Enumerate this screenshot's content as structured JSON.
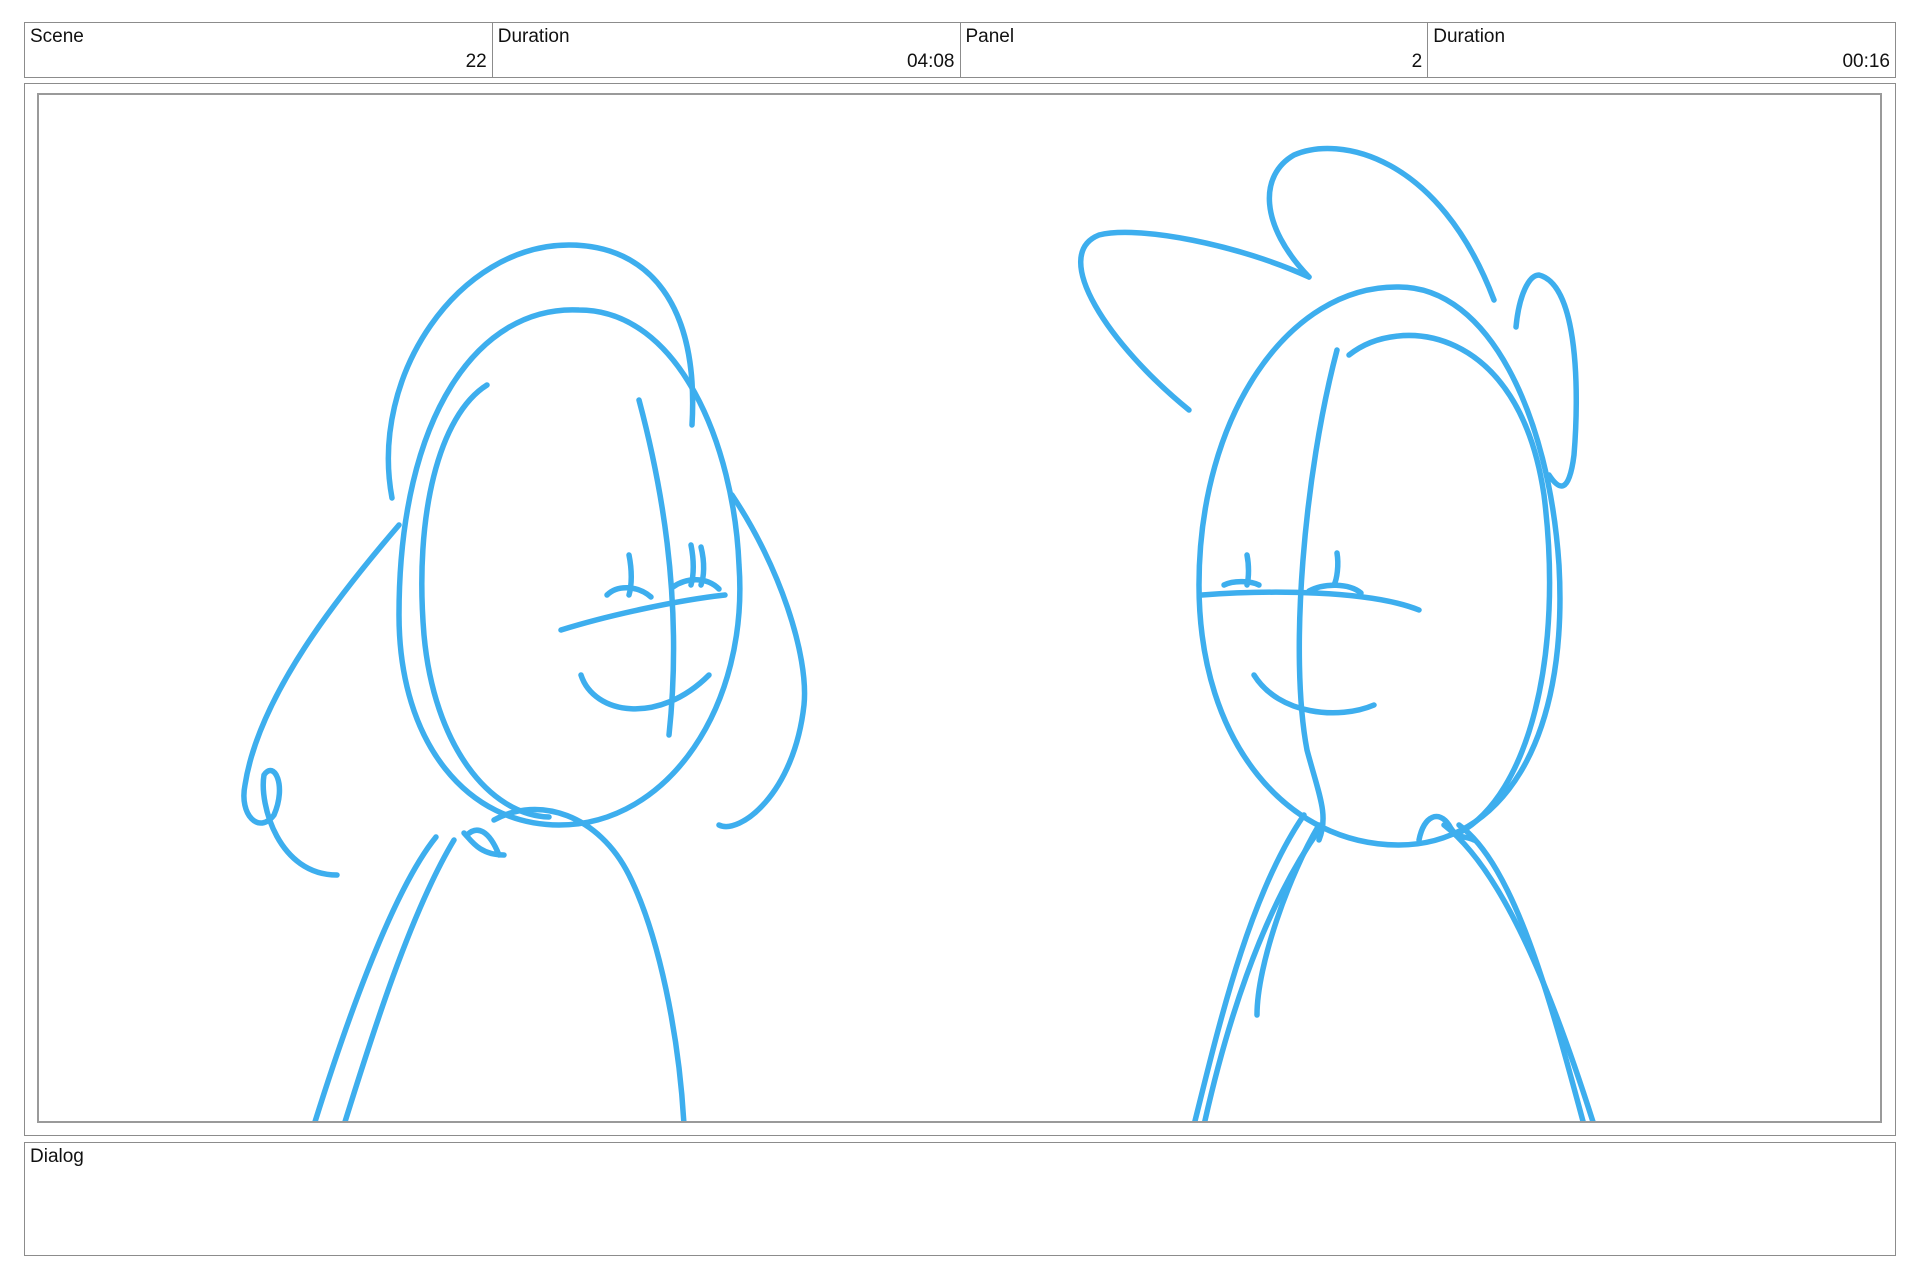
{
  "header": {
    "cells": [
      {
        "label": "Scene",
        "value": "22"
      },
      {
        "label": "Duration",
        "value": "04:08"
      },
      {
        "label": "Panel",
        "value": "2"
      },
      {
        "label": "Duration",
        "value": "00:16"
      }
    ]
  },
  "dialog": {
    "label": "Dialog",
    "text": ""
  },
  "colors": {
    "sketch_stroke": "#3daeee",
    "border": "#8c8c8c"
  }
}
